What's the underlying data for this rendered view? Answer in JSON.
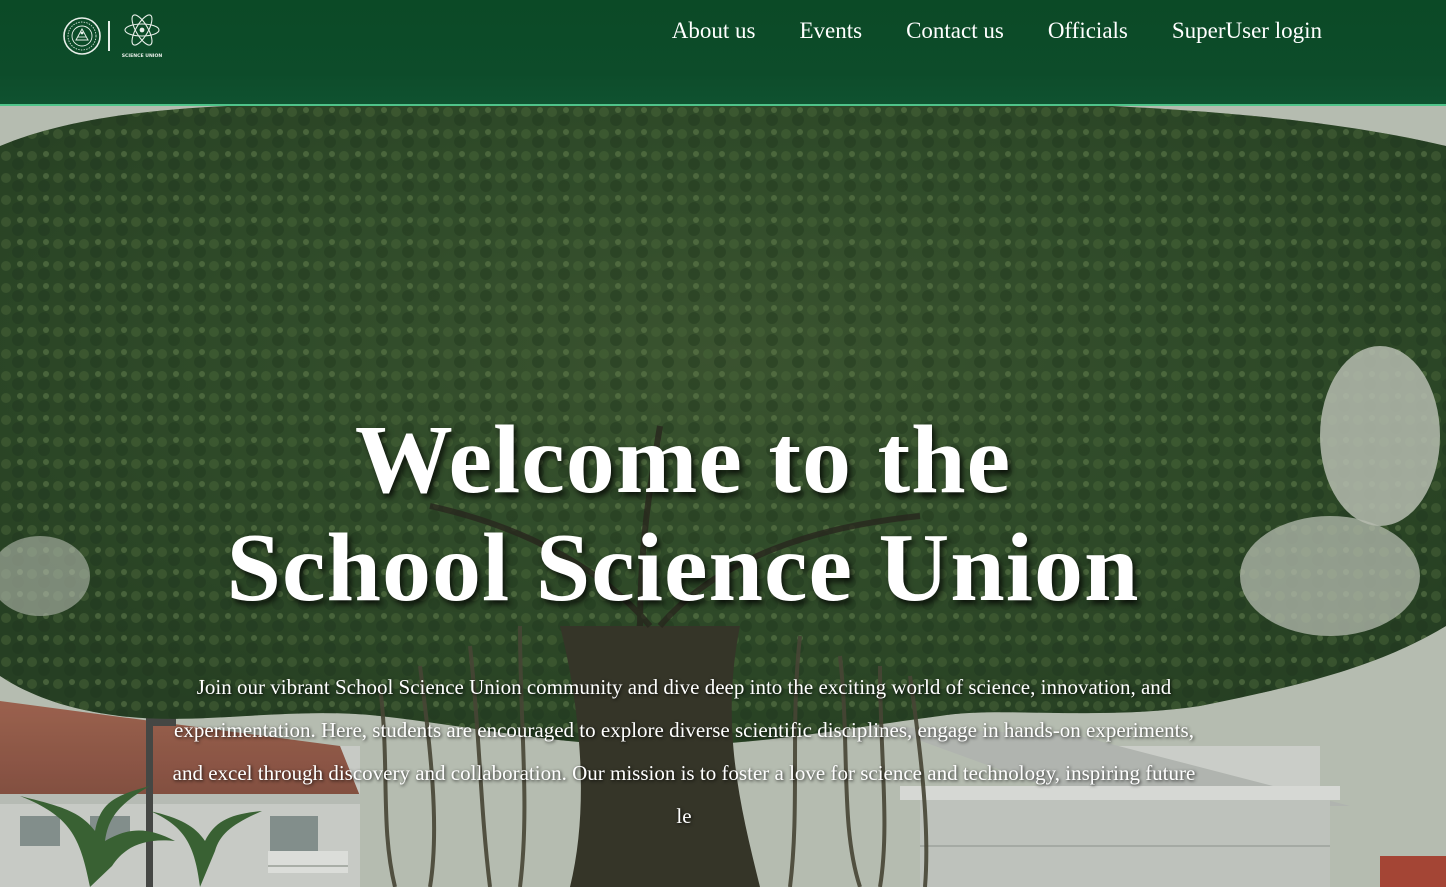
{
  "header": {
    "nav": [
      {
        "label": "About us"
      },
      {
        "label": "Events"
      },
      {
        "label": "Contact us"
      },
      {
        "label": "Officials"
      },
      {
        "label": "SuperUser login"
      }
    ],
    "logo_icons": [
      "school-seal-icon",
      "science-union-atom-icon"
    ],
    "logo_caption": "SCIENCE UNION",
    "background_color": "#0d4c2a",
    "accent_border_color": "#4fc48a"
  },
  "hero": {
    "title_line1": "Welcome to the",
    "title_line2": "School Science Union",
    "description": "Join our vibrant School Science Union community and dive deep into the exciting world of science, innovation, and experimentation. Here, students are encouraged to explore diverse scientific disciplines, engage in hands-on experiments, and excel through discovery and collaboration. Our mission is to foster a love for science and technology, inspiring future le",
    "text_color": "#ffffff"
  }
}
